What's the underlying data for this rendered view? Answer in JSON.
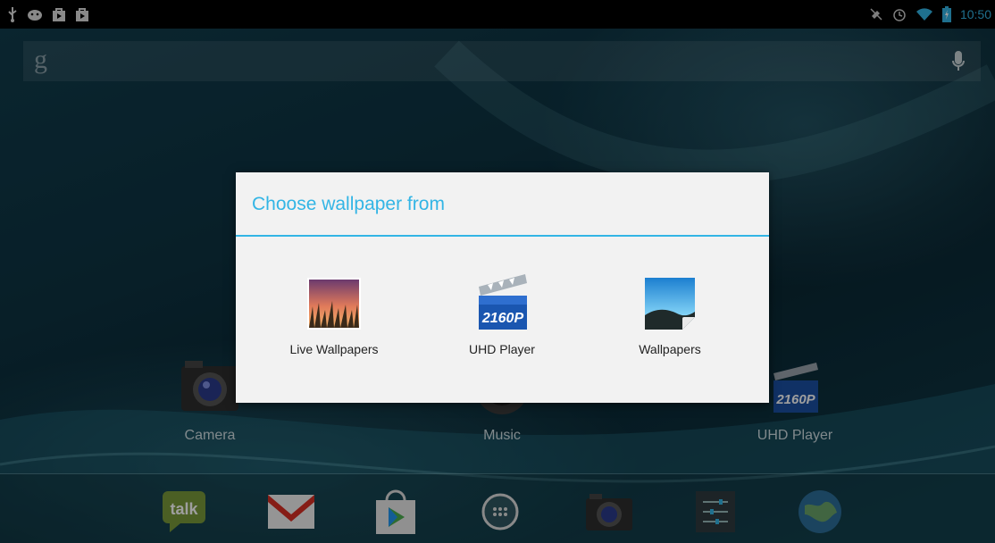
{
  "status_bar": {
    "left_icons": [
      "usb-icon",
      "android-debug-icon",
      "store-notification-icon",
      "store-notification-icon"
    ],
    "right_icons": [
      "mute-icon",
      "alarm-icon",
      "wifi-icon",
      "battery-charging-icon"
    ],
    "time": "10:50"
  },
  "search": {
    "logo": "g",
    "mic_icon": "microphone-icon"
  },
  "home_apps": [
    {
      "label": "Camera",
      "icon": "camera-icon"
    },
    {
      "label": "Music",
      "icon": "music-icon"
    },
    {
      "label": "UHD Player",
      "icon": "uhd-player-icon"
    }
  ],
  "dock": [
    {
      "name": "talk",
      "icon": "talk-icon",
      "text": "talk"
    },
    {
      "name": "gmail",
      "icon": "gmail-icon"
    },
    {
      "name": "play-store",
      "icon": "play-store-icon"
    },
    {
      "name": "all-apps",
      "icon": "all-apps-icon"
    },
    {
      "name": "camera",
      "icon": "camera-icon"
    },
    {
      "name": "settings",
      "icon": "settings-icon"
    },
    {
      "name": "browser",
      "icon": "globe-icon"
    }
  ],
  "dialog": {
    "title": "Choose wallpaper from",
    "options": [
      {
        "label": "Live Wallpapers",
        "icon": "live-wallpapers-icon"
      },
      {
        "label": "UHD Player",
        "icon": "uhd-player-icon",
        "icon_text": "2160P"
      },
      {
        "label": "Wallpapers",
        "icon": "wallpapers-icon"
      }
    ]
  },
  "colors": {
    "accent": "#33b5e5",
    "dialog_bg": "#f2f2f2"
  }
}
